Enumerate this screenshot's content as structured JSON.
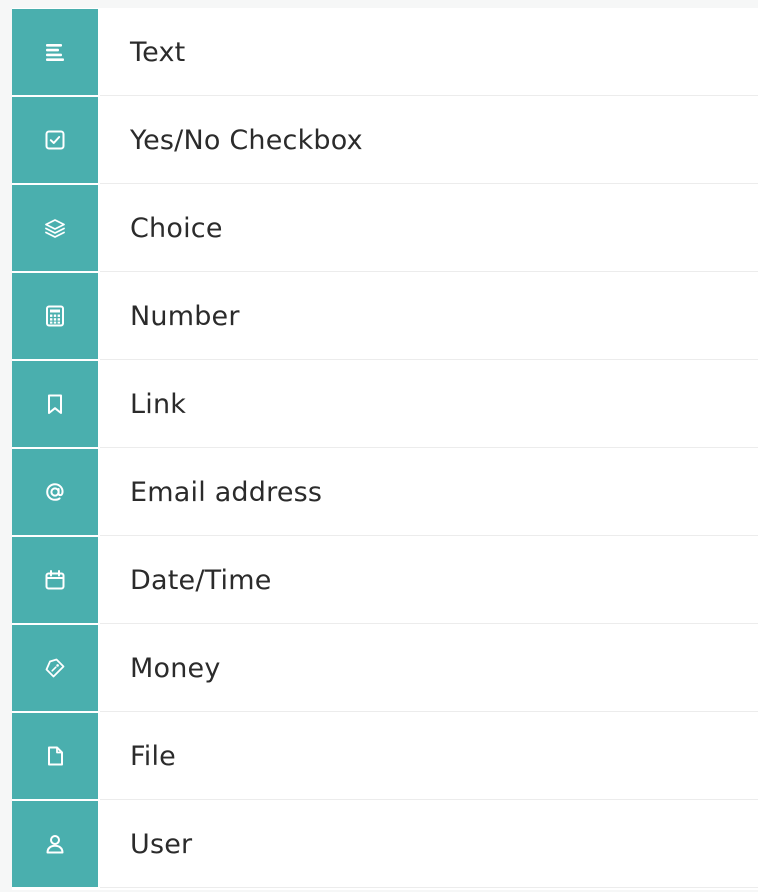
{
  "accent_color": "#4aafae",
  "field_types": [
    {
      "label": "Text",
      "icon": "text-lines-icon"
    },
    {
      "label": "Yes/No Checkbox",
      "icon": "checkbox-icon"
    },
    {
      "label": "Choice",
      "icon": "layers-icon"
    },
    {
      "label": "Number",
      "icon": "calculator-icon"
    },
    {
      "label": "Link",
      "icon": "bookmark-icon"
    },
    {
      "label": "Email address",
      "icon": "at-sign-icon"
    },
    {
      "label": "Date/Time",
      "icon": "calendar-icon"
    },
    {
      "label": "Money",
      "icon": "price-tag-icon"
    },
    {
      "label": "File",
      "icon": "file-icon"
    },
    {
      "label": "User",
      "icon": "user-icon"
    }
  ]
}
